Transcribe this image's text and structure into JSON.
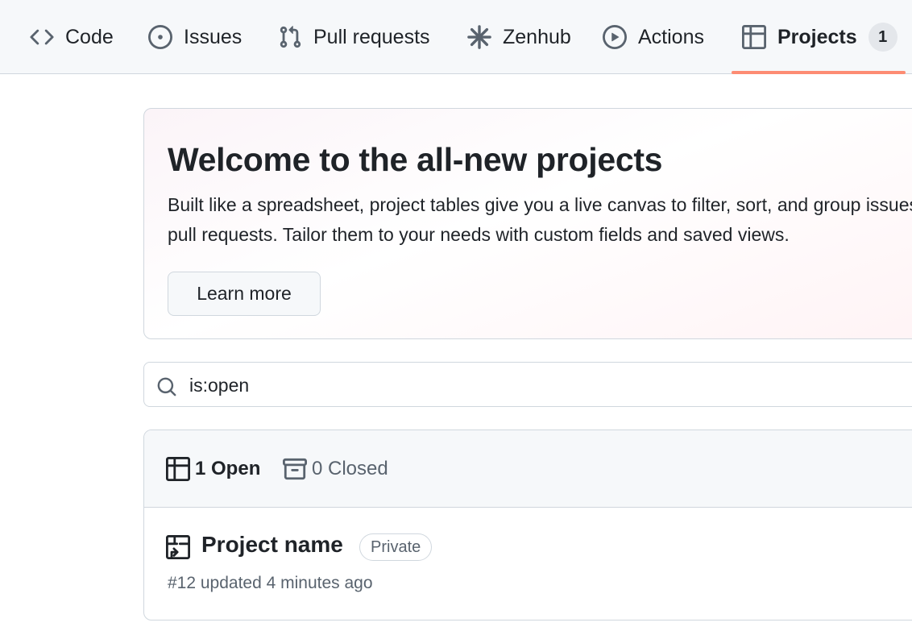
{
  "nav": {
    "tabs": [
      {
        "label": "Code",
        "icon": "code-icon"
      },
      {
        "label": "Issues",
        "icon": "issue-opened-icon"
      },
      {
        "label": "Pull requests",
        "icon": "git-pull-request-icon"
      },
      {
        "label": "Zenhub",
        "icon": "zenhub-asterisk-icon"
      },
      {
        "label": "Actions",
        "icon": "play-icon"
      },
      {
        "label": "Projects",
        "icon": "table-icon",
        "counter": "1",
        "selected": true
      }
    ]
  },
  "banner": {
    "title": "Welcome to the all-new projects",
    "description": "Built like a spreadsheet, project tables give you a live canvas to filter, sort, and group issues and pull requests. Tailor them to your needs with custom fields and saved views.",
    "button_label": "Learn more"
  },
  "search": {
    "value": "is:open",
    "icon": "search-icon"
  },
  "list": {
    "open_label": "1 Open",
    "closed_label": "0 Closed",
    "items": [
      {
        "name": "Project name",
        "visibility": "Private",
        "meta": "#12 updated 4 minutes ago",
        "icon": "project-icon"
      }
    ]
  },
  "colors": {
    "accent_underline": "#fd8c73",
    "muted_text": "#59636e",
    "border": "#d0d7de"
  }
}
